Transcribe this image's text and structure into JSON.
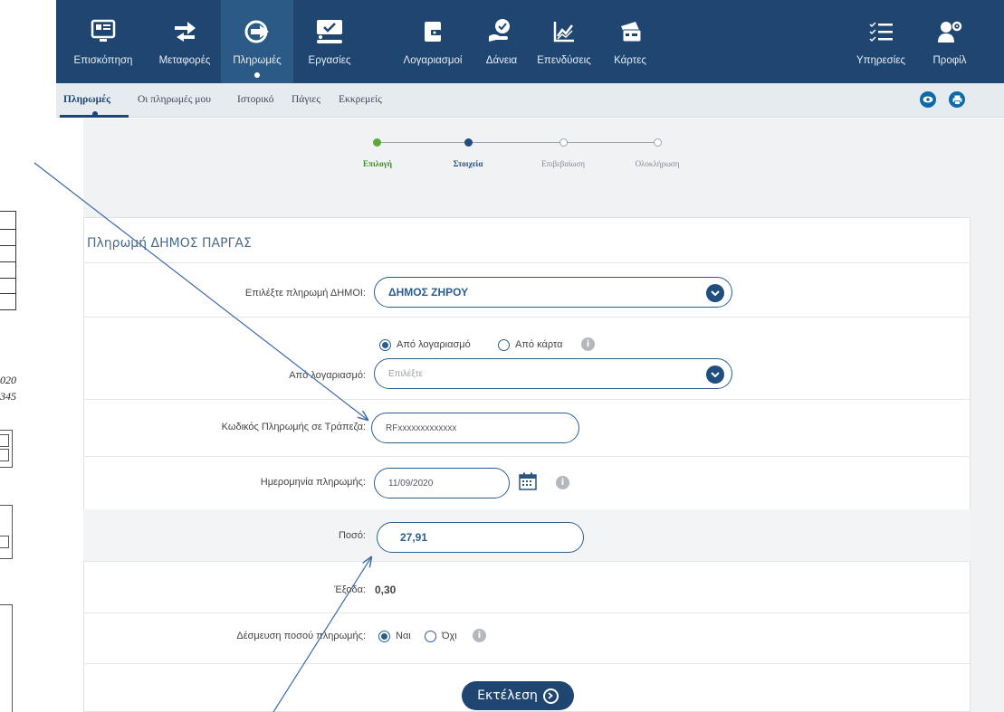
{
  "top_nav": {
    "items": [
      {
        "label": "Επισκόπηση",
        "icon": "overview-icon"
      },
      {
        "label": "Μεταφορές",
        "icon": "transfer-arrows-icon"
      },
      {
        "label": "Πληρωμές",
        "icon": "payments-icon",
        "active": true
      },
      {
        "label": "Εργασίες",
        "icon": "tasks-icon"
      },
      {
        "label": "Λογαριασμοί",
        "icon": "wallet-icon"
      },
      {
        "label": "Δάνεια",
        "icon": "loans-hand-icon"
      },
      {
        "label": "Επενδύσεις",
        "icon": "investments-chart-icon"
      },
      {
        "label": "Κάρτες",
        "icon": "cards-icon"
      },
      {
        "label": "Υπηρεσίες",
        "icon": "services-list-icon"
      },
      {
        "label": "Προφίλ",
        "icon": "profile-gear-icon"
      }
    ]
  },
  "sub_nav": {
    "items": [
      {
        "label": "Πληρωμές",
        "active": true
      },
      {
        "label": "Οι πληρωμές μου"
      },
      {
        "label": "Ιστορικό"
      },
      {
        "label": "Πάγιες"
      },
      {
        "label": "Εκκρεμείς"
      }
    ]
  },
  "doc_fragment": {
    "line1": "020",
    "line2": "345"
  },
  "stepper": {
    "steps": [
      {
        "label": "Επιλογή",
        "state": "done"
      },
      {
        "label": "Στοιχεία",
        "state": "current"
      },
      {
        "label": "Επιβεβαίωση",
        "state": "pending"
      },
      {
        "label": "Ολοκλήρωση",
        "state": "pending"
      }
    ]
  },
  "form": {
    "title": "Πληρωμή ΔΗΜΟΣ ΠΑΡΓΑΣ",
    "municipality": {
      "label": "Επιλέξτε πληρωμή ΔΗΜΟΙ:",
      "value": "ΔΗΜΟΣ ΖΗΡΟΥ"
    },
    "source": {
      "option_account": "Από λογαριασμό",
      "option_card": "Από κάρτα",
      "selected": "account"
    },
    "from_account": {
      "label": "Από λογαριασμό:",
      "placeholder": "Επιλέξτε"
    },
    "payment_code": {
      "label": "Κωδικός Πληρωμής σε Τράπεζα:",
      "value": "RFxxxxxxxxxxxxx"
    },
    "payment_date": {
      "label": "Ημερομηνία πληρωμής:",
      "value": "11/09/2020"
    },
    "amount": {
      "label": "Ποσό:",
      "value": "27,91"
    },
    "fees": {
      "label": "Έξοδα:",
      "value": "0,30"
    },
    "hold": {
      "label": "Δέσμευση ποσού πληρωμής:",
      "yes": "Ναι",
      "no": "Όχι",
      "selected": "yes"
    },
    "submit_label": "Εκτέλεση"
  },
  "colors": {
    "nav_bg": "#1f4670",
    "accent": "#2b5d8e",
    "step_done": "#5aa83a",
    "step_current": "#1f4e7f"
  }
}
